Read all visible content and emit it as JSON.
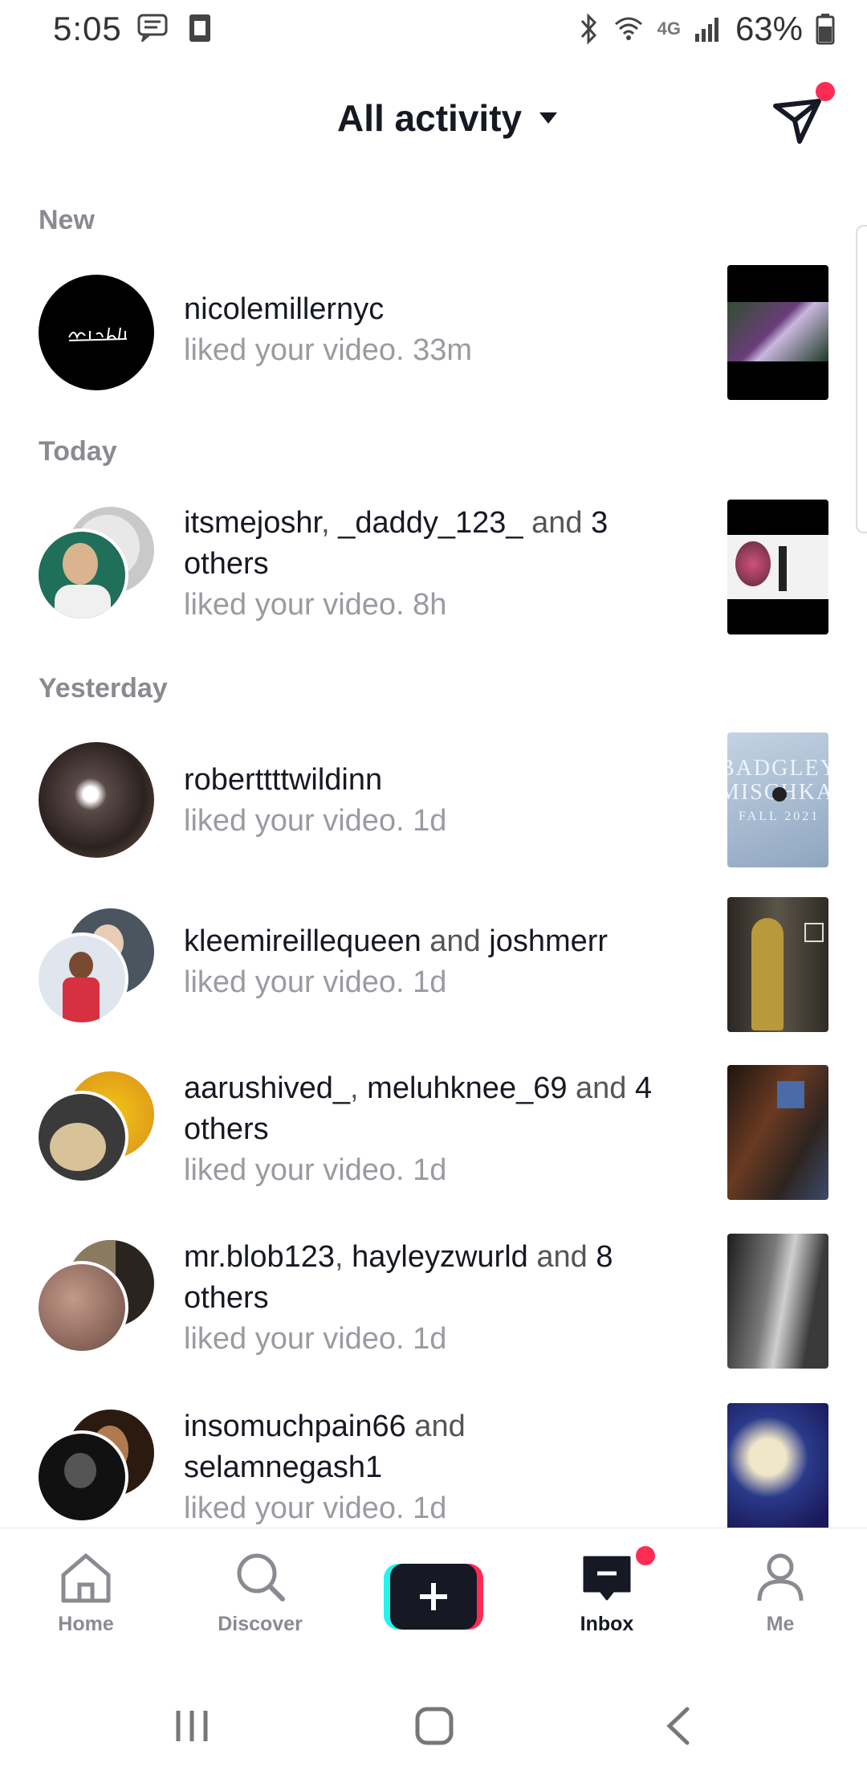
{
  "status_bar": {
    "time": "5:05",
    "network": "4G",
    "battery": "63%"
  },
  "header": {
    "title": "All activity"
  },
  "sections": {
    "new": "New",
    "today": "Today",
    "yesterday": "Yesterday"
  },
  "notifications": [
    {
      "users": [
        "nicolemillernyc"
      ],
      "connector": "",
      "action": "liked your video.",
      "time": "33m"
    },
    {
      "users": [
        "itsmejoshr",
        "_daddy_123_"
      ],
      "connector_mid": ", ",
      "connector": " and ",
      "others": "3 others",
      "action": "liked your video.",
      "time": "8h"
    },
    {
      "users": [
        "roberttttwildinn"
      ],
      "action": "liked your video.",
      "time": "1d"
    },
    {
      "users": [
        "kleemireillequeen",
        "joshmerr"
      ],
      "connector": " and ",
      "action": "liked your video.",
      "time": "1d"
    },
    {
      "users": [
        "aarushived_",
        "meluhknee_69"
      ],
      "connector_mid": ", ",
      "connector": " and ",
      "others": "4 others",
      "action": "liked your video.",
      "time": "1d"
    },
    {
      "users": [
        "mr.blob123",
        "hayleyzwurld"
      ],
      "connector_mid": ", ",
      "connector": " and ",
      "others": "8 others",
      "action": "liked your video.",
      "time": "1d"
    },
    {
      "users": [
        "insomuchpain66",
        "selamnegash1"
      ],
      "connector": " and ",
      "action": "liked your video.",
      "time": "1d"
    }
  ],
  "thumb_text": {
    "badgley": "BADGLEY MISCHKA",
    "fall": "FALL 2021"
  },
  "bottom_nav": {
    "home": "Home",
    "discover": "Discover",
    "inbox": "Inbox",
    "me": "Me"
  },
  "colors": {
    "accent": "#fe2c55",
    "cyan": "#25f4ee",
    "text": "#161823",
    "secondary": "#8a8b91"
  }
}
